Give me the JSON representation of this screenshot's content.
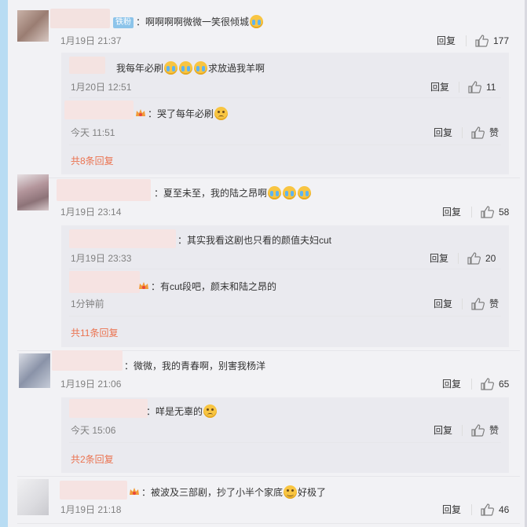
{
  "comments": [
    {
      "badge": "铁粉",
      "text": "：啊啊啊啊微微一笑很倾城",
      "time": "1月19日 21:37",
      "reply": "回复",
      "likes": "177",
      "subs": [
        {
          "text_pre": "我每年必刷",
          "text_post": "求放過我羊啊",
          "time": "1月20日 12:51",
          "reply": "回复",
          "likes": "11"
        },
        {
          "text": "：哭了每年必刷",
          "time": "今天 11:51",
          "reply": "回复",
          "likes": "赞"
        }
      ],
      "more": "共8条回复"
    },
    {
      "text": "：夏至未至，我的陆之昂啊",
      "time": "1月19日 23:14",
      "reply": "回复",
      "likes": "58",
      "subs": [
        {
          "text": "：其实我看这剧也只看的颜值夫妇cut",
          "time": "1月19日 23:33",
          "reply": "回复",
          "likes": "20"
        },
        {
          "text": "：有cut段吧，颜末和陆之昂的",
          "time": "1分钟前",
          "reply": "回复",
          "likes": "赞"
        }
      ],
      "more": "共11条回复"
    },
    {
      "text": "：微微，我的青春啊，别害我杨洋",
      "time": "1月19日 21:06",
      "reply": "回复",
      "likes": "65",
      "subs": [
        {
          "text": "：咩是无辜的",
          "time": "今天 15:06",
          "reply": "回复",
          "likes": "赞"
        }
      ],
      "more": "共2条回复"
    },
    {
      "text_pre": "：被波及三部剧，抄了小半个家底",
      "text_post": "好极了",
      "time": "1月19日 21:18",
      "reply": "回复",
      "likes": "46"
    }
  ],
  "colors": {
    "accent_orange": "#eb7350",
    "badge_blue": "#8cc4ea",
    "side_bar": "#b8dcf3"
  },
  "icons": {
    "like": "thumbs-up-icon",
    "cry": "crying-emoji-icon",
    "sad": "sad-emoji-icon",
    "smile": "smile-emoji-icon",
    "vip": "vip-crown-icon"
  }
}
